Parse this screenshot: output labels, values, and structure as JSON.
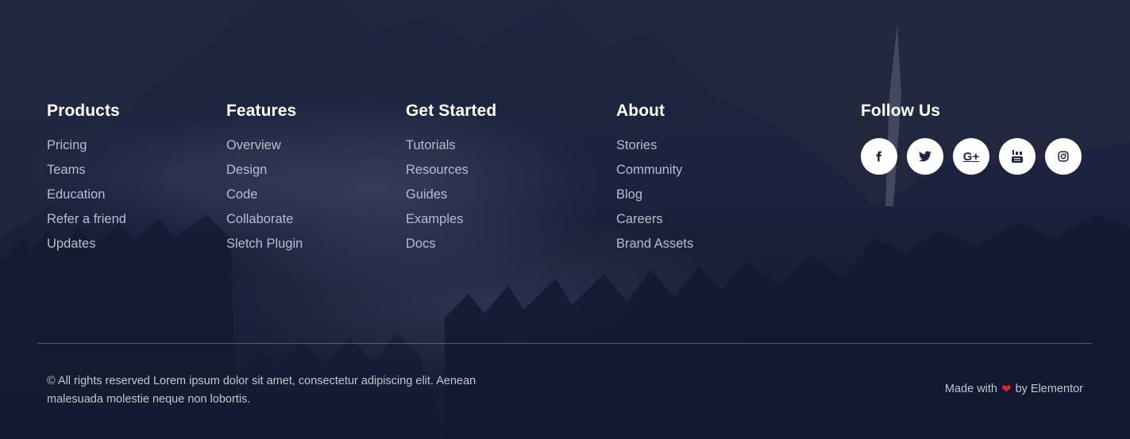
{
  "columns": [
    {
      "title": "Products",
      "items": [
        "Pricing",
        "Teams",
        "Education",
        "Refer a friend",
        "Updates"
      ]
    },
    {
      "title": "Features",
      "items": [
        "Overview",
        "Design",
        "Code",
        "Collaborate",
        "Sletch Plugin"
      ]
    },
    {
      "title": "Get Started",
      "items": [
        "Tutorials",
        "Resources",
        "Guides",
        "Examples",
        "Docs"
      ]
    },
    {
      "title": "About",
      "items": [
        "Stories",
        "Community",
        "Blog",
        "Careers",
        "Brand Assets"
      ]
    }
  ],
  "follow": {
    "title": "Follow Us",
    "icons": [
      "facebook-icon",
      "twitter-icon",
      "google-plus-icon",
      "youtube-icon",
      "instagram-icon"
    ],
    "google_plus_glyph": "G+"
  },
  "footer": {
    "copyright": "© All rights reserved Lorem ipsum dolor sit amet, consectetur adipiscing elit. Aenean malesuada molestie neque non lobortis.",
    "made_with": "Made with",
    "heart": "❤",
    "by": "by Elementor"
  },
  "colors": {
    "background": "#1c2540",
    "heading": "#ffffff",
    "link": "#b9bdcc",
    "icon_bg": "#ffffff",
    "icon_fg": "#1d2747",
    "heart": "#e0242b"
  }
}
